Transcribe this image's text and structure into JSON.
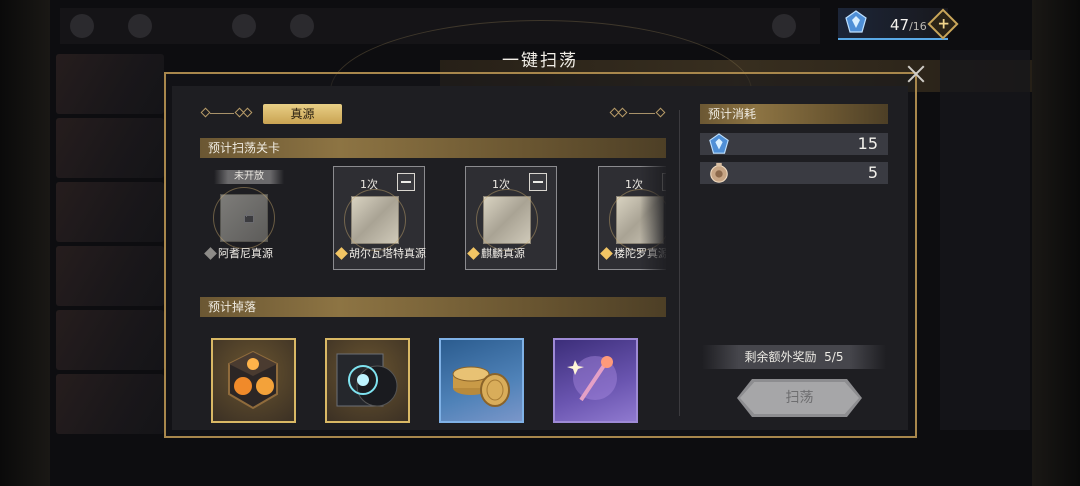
{
  "header": {
    "title": "一键扫荡",
    "currency": {
      "icon": "stamina-crystal-icon",
      "amount": "47",
      "max": "/16"
    }
  },
  "tabs": [
    {
      "label": "真源",
      "active": true
    }
  ],
  "stages_section": {
    "title": "预计扫荡关卡",
    "stages": [
      {
        "name": "阿耆尼真源",
        "locked": true,
        "lock_label": "未开放"
      },
      {
        "name": "胡尔瓦塔特真源",
        "locked": false,
        "count": "1次"
      },
      {
        "name": "麒麟真源",
        "locked": false,
        "count": "1次"
      },
      {
        "name": "楼陀罗真源",
        "locked": false,
        "count": "1次"
      }
    ]
  },
  "drops_section": {
    "title": "预计掉落",
    "items": [
      {
        "icon": "fire-cube-icon",
        "rarity": "gold"
      },
      {
        "icon": "eye-record-icon",
        "rarity": "gold"
      },
      {
        "icon": "gold-coins-icon",
        "rarity": "blue"
      },
      {
        "icon": "purple-wand-icon",
        "rarity": "purple"
      }
    ]
  },
  "cost_section": {
    "title": "预计消耗",
    "costs": [
      {
        "icon": "stamina-crystal-icon",
        "value": "15"
      },
      {
        "icon": "bronze-ticket-icon",
        "value": "5"
      }
    ]
  },
  "bonus": {
    "label": "剩余额外奖励",
    "value": "5/5"
  },
  "sweep_button": {
    "label": "扫荡",
    "enabled": false
  },
  "colors": {
    "accent_gold": "#c9a352",
    "dialog_border": "#a8874c",
    "currency_underline": "#5aa9e6",
    "disabled_button": "#a6a6a8"
  }
}
